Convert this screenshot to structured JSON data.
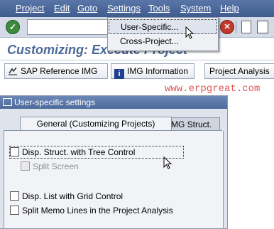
{
  "menubar": {
    "items": [
      {
        "label": "Project"
      },
      {
        "label": "Edit"
      },
      {
        "label": "Goto"
      },
      {
        "label": "Settings"
      },
      {
        "label": "Tools"
      },
      {
        "label": "System"
      },
      {
        "label": "Help"
      }
    ]
  },
  "settings_menu": {
    "items": [
      {
        "label": "User-Specific..."
      },
      {
        "label": "Cross-Project..."
      }
    ]
  },
  "page": {
    "title": "Customizing: Execute Project"
  },
  "toolbar": {
    "command_field_value": "",
    "check_icon": "check-icon",
    "cancel_icon": "cancel-icon",
    "print_icon": "print-icon",
    "find_icon": "binoculars-icon"
  },
  "app_buttons": [
    {
      "label": "SAP Reference IMG",
      "icon": "sap-reference-img-icon"
    },
    {
      "label": "IMG Information",
      "icon": "info-icon"
    },
    {
      "label": "Project Analysis"
    }
  ],
  "watermark": "www.erpgreat.com",
  "dialog": {
    "title": "User-specific settings",
    "tabs": [
      {
        "label": "General (Customizing Projects)",
        "active": true
      },
      {
        "label": "IMG Struct.",
        "active": false
      }
    ],
    "options": [
      {
        "label": "Disp. Struct. with Tree Control",
        "checked": false,
        "enabled": true
      },
      {
        "label": "Split Screen",
        "checked": false,
        "enabled": false
      },
      {
        "label": "Disp. List with Grid Control",
        "checked": false,
        "enabled": true
      },
      {
        "label": "Split Memo Lines in the Project Analysis",
        "checked": false,
        "enabled": true
      }
    ]
  },
  "colors": {
    "menubar": "#4a6799",
    "title": "#4b6a99",
    "watermark": "#e05555"
  }
}
